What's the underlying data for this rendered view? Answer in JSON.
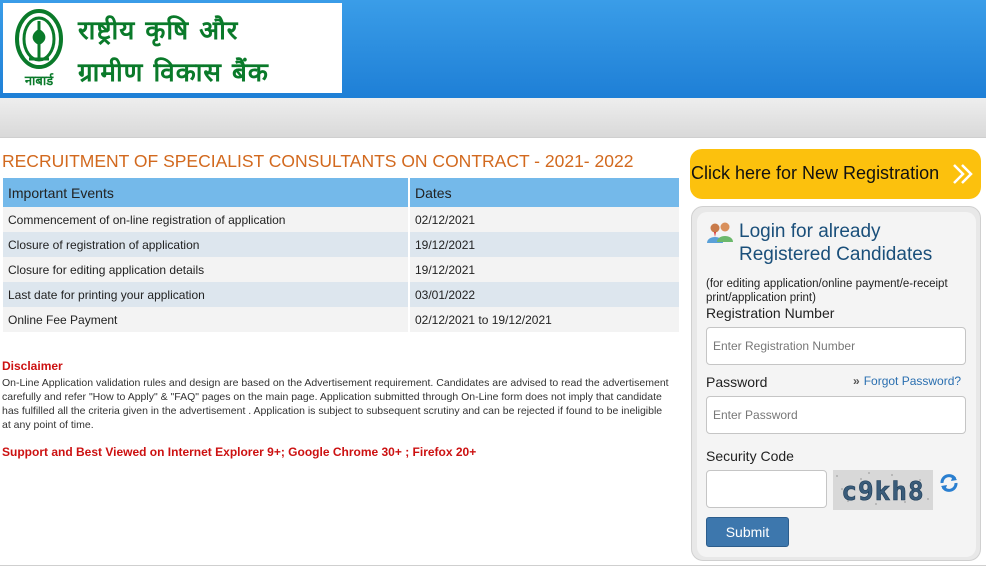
{
  "header": {
    "logo_text_line1": "राष्ट्रीय कृषि और",
    "logo_text_line2": "ग्रामीण विकास बैंक",
    "emblem_caption": "नाबार्ड"
  },
  "main": {
    "title": "RECRUITMENT OF SPECIALIST CONSULTANTS ON CONTRACT - 2021- 2022",
    "table": {
      "headers": [
        "Important Events",
        "Dates"
      ],
      "rows": [
        [
          "Commencement of on-line registration of application",
          "02/12/2021"
        ],
        [
          "Closure of registration of application",
          "19/12/2021"
        ],
        [
          "Closure for editing application details",
          "19/12/2021"
        ],
        [
          "Last date for printing your application",
          "03/01/2022"
        ],
        [
          "Online Fee Payment",
          "02/12/2021 to 19/12/2021"
        ]
      ]
    },
    "disclaimer_title": "Disclaimer",
    "disclaimer_text": "On-Line Application validation rules and design are based on the Advertisement requirement. Candidates are advised to read the advertisement carefully and refer \"How to Apply\" & \"FAQ\" pages on the main page. Application submitted through On-Line form does not imply that candidate has fulfilled all the criteria given in the advertisement . Application is subject to subsequent scrutiny and can be rejected if found to be ineligible at any point of time.",
    "support_text": "Support and Best Viewed on Internet Explorer 9+; Google Chrome 30+ ; Firefox 20+"
  },
  "sidebar": {
    "new_registration_label": "Click here for New Registration",
    "login_title_line1": "Login for already",
    "login_title_line2": "Registered Candidates",
    "login_note": "(for editing application/online payment/e-receipt print/application print)",
    "registration_label": "Registration Number",
    "registration_placeholder": "Enter Registration Number",
    "password_label": "Password",
    "password_placeholder": "Enter Password",
    "forgot_password": "Forgot Password?",
    "security_label": "Security Code",
    "captcha_text": "c9kh8",
    "submit_label": "Submit"
  },
  "colors": {
    "header_blue": "#1e7fd6",
    "title_orange": "#d2691e",
    "registration_yellow": "#fcc10d",
    "table_header_blue": "#74b9ea",
    "disclaimer_red": "#cc1111",
    "submit_blue": "#3d77ad"
  },
  "icons": [
    "nabard-emblem-icon",
    "double-chevron-right-icon",
    "users-icon",
    "refresh-icon"
  ]
}
